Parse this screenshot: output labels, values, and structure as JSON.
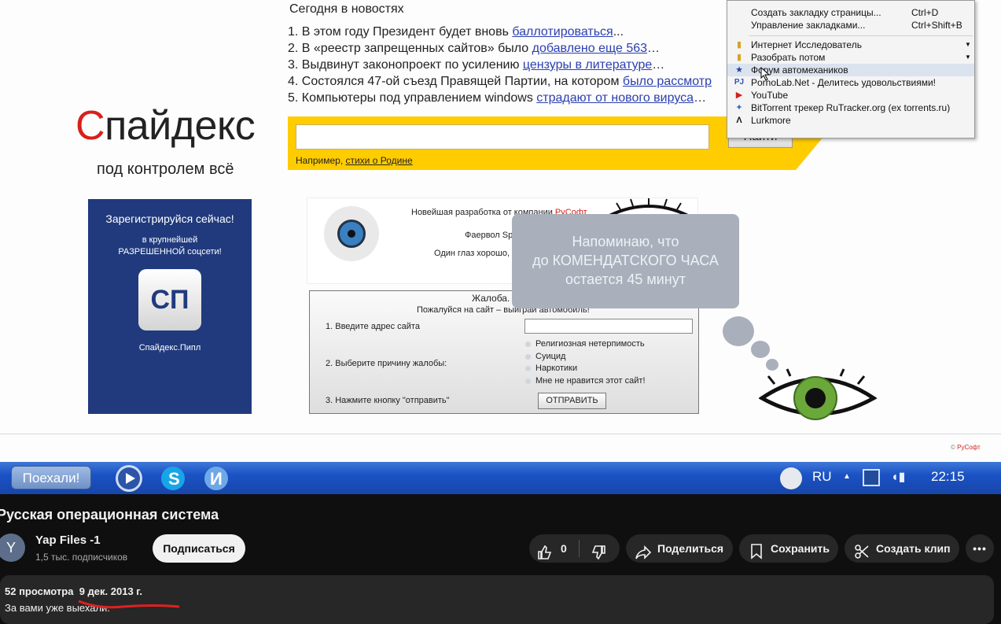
{
  "video": {
    "news": {
      "heading": "Сегодня в новостях",
      "items": [
        {
          "prefix": "1. В этом году Президент будет вновь ",
          "link": "баллотироваться",
          "suffix": "..."
        },
        {
          "prefix": "2. В «реестр запрещенных сайтов» было ",
          "link": "добавлено еще 563",
          "suffix": "…"
        },
        {
          "prefix": "3. Выдвинут законопроект по усилению ",
          "link": "цензуры в литературе",
          "suffix": "…"
        },
        {
          "prefix": "4. Состоялся 47-ой съезд Правящей Партии, на котором ",
          "link": "было рассмотр",
          "suffix": ""
        },
        {
          "prefix": "5. Компьютеры под управлением windows ",
          "link": "страдают от нового вируса",
          "suffix": "…"
        }
      ]
    },
    "logo": {
      "first": "С",
      "rest": "пайдекс",
      "tagline": "под контролем всё"
    },
    "search": {
      "button": "Найти",
      "example_prefix": "Например, ",
      "example_link": "стихи о Родине"
    },
    "register": {
      "title": "Зарегистрируйся сейчас!",
      "line1": "в крупнейшей",
      "line2": "РАЗРЕШЕННОЙ соцсети!",
      "logo_text": "СП",
      "footer": "Спайдекс.Пипл"
    },
    "promo": {
      "line1_prefix": "Новейшая разработка от компании ",
      "line1_brand": "РуСофт",
      "line2": "Фаервол Sp",
      "line3": "Один глаз хорошо,"
    },
    "bubble": {
      "line1": "Напоминаю, что",
      "line2": "до КОМЕНДАТСКОГО ЧАСА",
      "line3": "остается 45 минут"
    },
    "complaint": {
      "title": "Жалоба.",
      "subtitle": "Пожалуйся на сайт – выиграй автомобиль!",
      "step1": "1. Введите адрес сайта",
      "step2": "2. Выберите причину жалобы:",
      "step3": "3. Нажмите кнопку \"отправить\"",
      "options": [
        "Религиозная нетерпимость",
        "Суицид",
        "Наркотики",
        "Мне не нравится этот сайт!"
      ],
      "submit": "ОТПРАВИТЬ"
    },
    "copyright_prefix": "© ",
    "copyright_brand": "РуСофт",
    "menu": {
      "items": [
        {
          "label": "Создать закладку страницы...",
          "shortcut": "Ctrl+D",
          "icon": ""
        },
        {
          "label": "Управление закладками...",
          "shortcut": "Ctrl+Shift+B",
          "icon": ""
        },
        {
          "label": "Интернет Исследователь",
          "shortcut": "",
          "icon": "folder-icon"
        },
        {
          "label": "Разобрать потом",
          "shortcut": "",
          "icon": "folder-icon"
        },
        {
          "label": "Форум автомехаников",
          "shortcut": "",
          "icon": "star-icon"
        },
        {
          "label": "PornoLab.Net - Делитесь удовольствиями!",
          "shortcut": "",
          "icon": "pl-icon"
        },
        {
          "label": "YouTube",
          "shortcut": "",
          "icon": "youtube-icon"
        },
        {
          "label": "BitTorrent трекер RuTracker.org (ex torrents.ru)",
          "shortcut": "",
          "icon": "torrent-icon"
        },
        {
          "label": "Lurkmore",
          "shortcut": "",
          "icon": "lambda-icon"
        }
      ]
    },
    "taskbar": {
      "start": "Поехали!",
      "lang": "RU",
      "time": "22:15"
    }
  },
  "meta": {
    "title": "Русская операционная система",
    "channel": {
      "avatar_letter": "Y",
      "name": "Yap Files -1",
      "subscribers": "1,5 тыс. подписчиков"
    },
    "subscribe": "Подписаться",
    "likes": "0",
    "share": "Поделиться",
    "save": "Сохранить",
    "clip": "Создать клип",
    "views": "52 просмотра",
    "date": "9 дек. 2013 г.",
    "description": "За вами уже выехали."
  }
}
